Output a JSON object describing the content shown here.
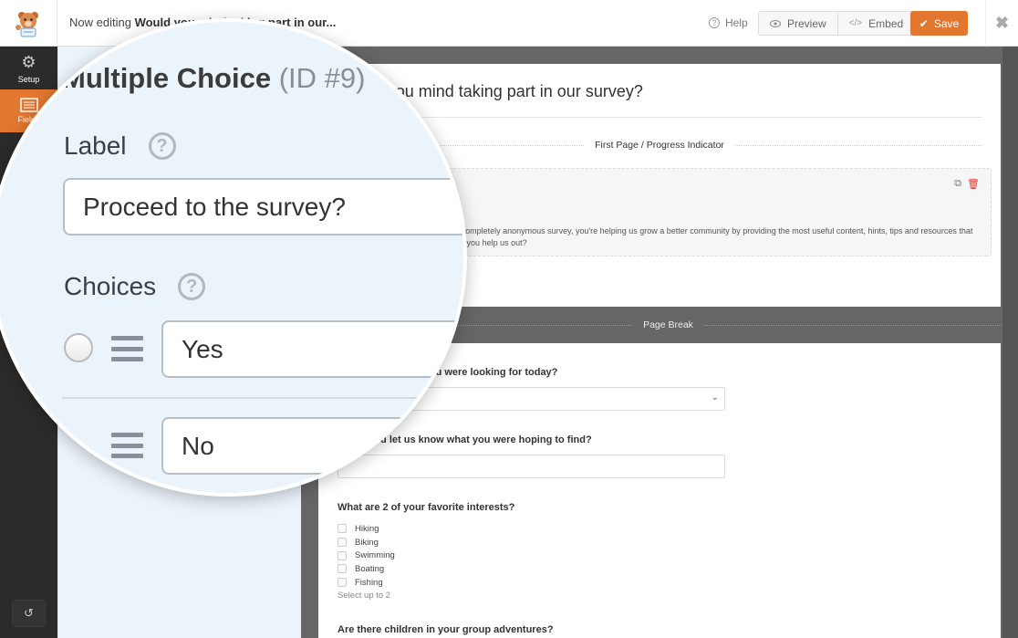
{
  "topbar": {
    "now_editing_prefix": "Now editing",
    "form_name_truncated": "Would you mind taking part in our...",
    "help_label": "Help",
    "preview_label": "Preview",
    "embed_label": "Embed",
    "save_label": "Save"
  },
  "leftnav": {
    "items": [
      {
        "label": "Setup",
        "icon": "gear-icon"
      },
      {
        "label": "Fields",
        "icon": "fields-list-icon",
        "active": true
      }
    ],
    "revisions_icon": "revisions-icon"
  },
  "field_options": {
    "field_type": "Multiple Choice",
    "field_id": "(ID #9)",
    "label_heading": "Label",
    "label_value": "Proceed to the survey?",
    "choices_heading": "Choices",
    "choices": [
      "Yes",
      "No"
    ]
  },
  "preview": {
    "form_title": "Would you mind taking part in our survey?",
    "first_page_label": "First Page / Progress Indicator",
    "intro_text": "By participating in this 100% completely anonymous survey, you're helping us grow a better community by providing the most useful content, hints, tips and resources that keep you coming back to! Will you help us out?",
    "page_break_label": "Page Break",
    "questions": [
      {
        "label": "Did you find what you were looking for today?",
        "type": "select"
      },
      {
        "label": "Could you let us know what you were hoping to find?",
        "type": "text"
      },
      {
        "label": "What are 2 of your favorite interests?",
        "type": "checkbox",
        "options": [
          "Hiking",
          "Biking",
          "Swimming",
          "Boating",
          "Fishing"
        ],
        "hint": "Select up to 2"
      },
      {
        "label": "Are there children in your group adventures?",
        "type": "radio"
      }
    ]
  },
  "colors": {
    "accent": "#e27730",
    "sidebar_bg": "#2b2b2b",
    "options_bg": "#ebf3fb",
    "delete_red": "#d63638"
  }
}
